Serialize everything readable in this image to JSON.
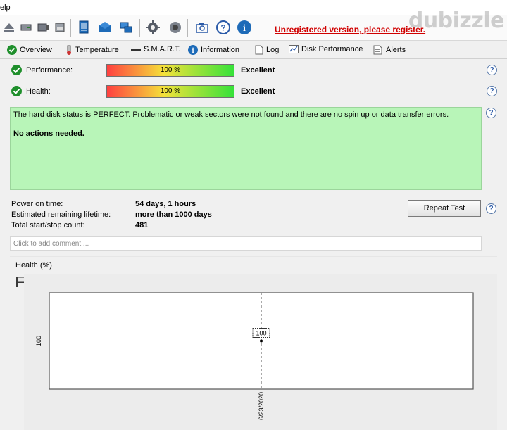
{
  "menubar": {
    "help": "elp"
  },
  "toolbar": {
    "icons": [
      "eject-icon",
      "drive-icon",
      "drive2-icon",
      "disk-icon",
      "report-icon",
      "mail-icon",
      "network-icon",
      "settings-icon",
      "speaker-icon",
      "camera-icon",
      "help-icon",
      "info-icon"
    ],
    "unregistered_link": "Unregistered version, please register."
  },
  "tabs": [
    "Overview",
    "Temperature",
    "S.M.A.R.T.",
    "Information",
    "Log",
    "Disk Performance",
    "Alerts"
  ],
  "performance": {
    "label": "Performance:",
    "percent_text": "100 %",
    "fraction": 1.0,
    "rating": "Excellent"
  },
  "health": {
    "label": "Health:",
    "percent_text": "100 %",
    "fraction": 1.0,
    "rating": "Excellent"
  },
  "status": {
    "message": "The hard disk status is PERFECT. Problematic or weak sectors were not found and there are no spin up or data transfer errors.",
    "action": "No actions needed."
  },
  "info": {
    "power_on_label": "Power on time:",
    "power_on_value": "54 days, 1 hours",
    "lifetime_label": "Estimated remaining lifetime:",
    "lifetime_value": "more than 1000 days",
    "startstop_label": "Total start/stop count:",
    "startstop_value": "481"
  },
  "buttons": {
    "repeat_test": "Repeat Test"
  },
  "comment": {
    "placeholder": "Click to add comment ..."
  },
  "watermark": "dubizzle",
  "colors": {
    "status_green": "#b8f5b8",
    "check_green": "#1f8f2c",
    "link_red": "#d00000"
  },
  "chart_data": {
    "type": "line",
    "title": "Health (%)",
    "x": [
      "6/23/2020"
    ],
    "series": [
      {
        "values": [
          100
        ]
      }
    ],
    "ytick": "100",
    "data_label": "100",
    "grid": true
  }
}
